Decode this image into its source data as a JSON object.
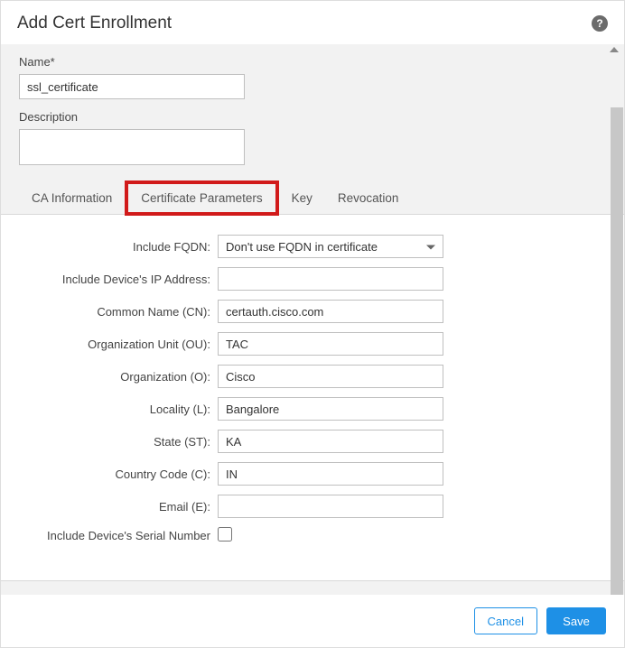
{
  "header": {
    "title": "Add Cert Enrollment"
  },
  "top": {
    "name_label": "Name*",
    "name_value": "ssl_certificate",
    "description_label": "Description",
    "description_value": ""
  },
  "tabs": {
    "ca_info": "CA Information",
    "cert_params": "Certificate Parameters",
    "key": "Key",
    "revocation": "Revocation"
  },
  "form": {
    "include_fqdn_label": "Include FQDN:",
    "include_fqdn_value": "Don't use FQDN in certificate",
    "include_ip_label": "Include Device's IP Address:",
    "include_ip_value": "",
    "cn_label": "Common Name (CN):",
    "cn_value": "certauth.cisco.com",
    "ou_label": "Organization Unit (OU):",
    "ou_value": "TAC",
    "o_label": "Organization (O):",
    "o_value": "Cisco",
    "l_label": "Locality (L):",
    "l_value": "Bangalore",
    "st_label": "State (ST):",
    "st_value": "KA",
    "c_label": "Country Code (C):",
    "c_value": "IN",
    "e_label": "Email (E):",
    "e_value": "",
    "serial_label": "Include Device's Serial Number"
  },
  "footer": {
    "cancel": "Cancel",
    "save": "Save"
  }
}
